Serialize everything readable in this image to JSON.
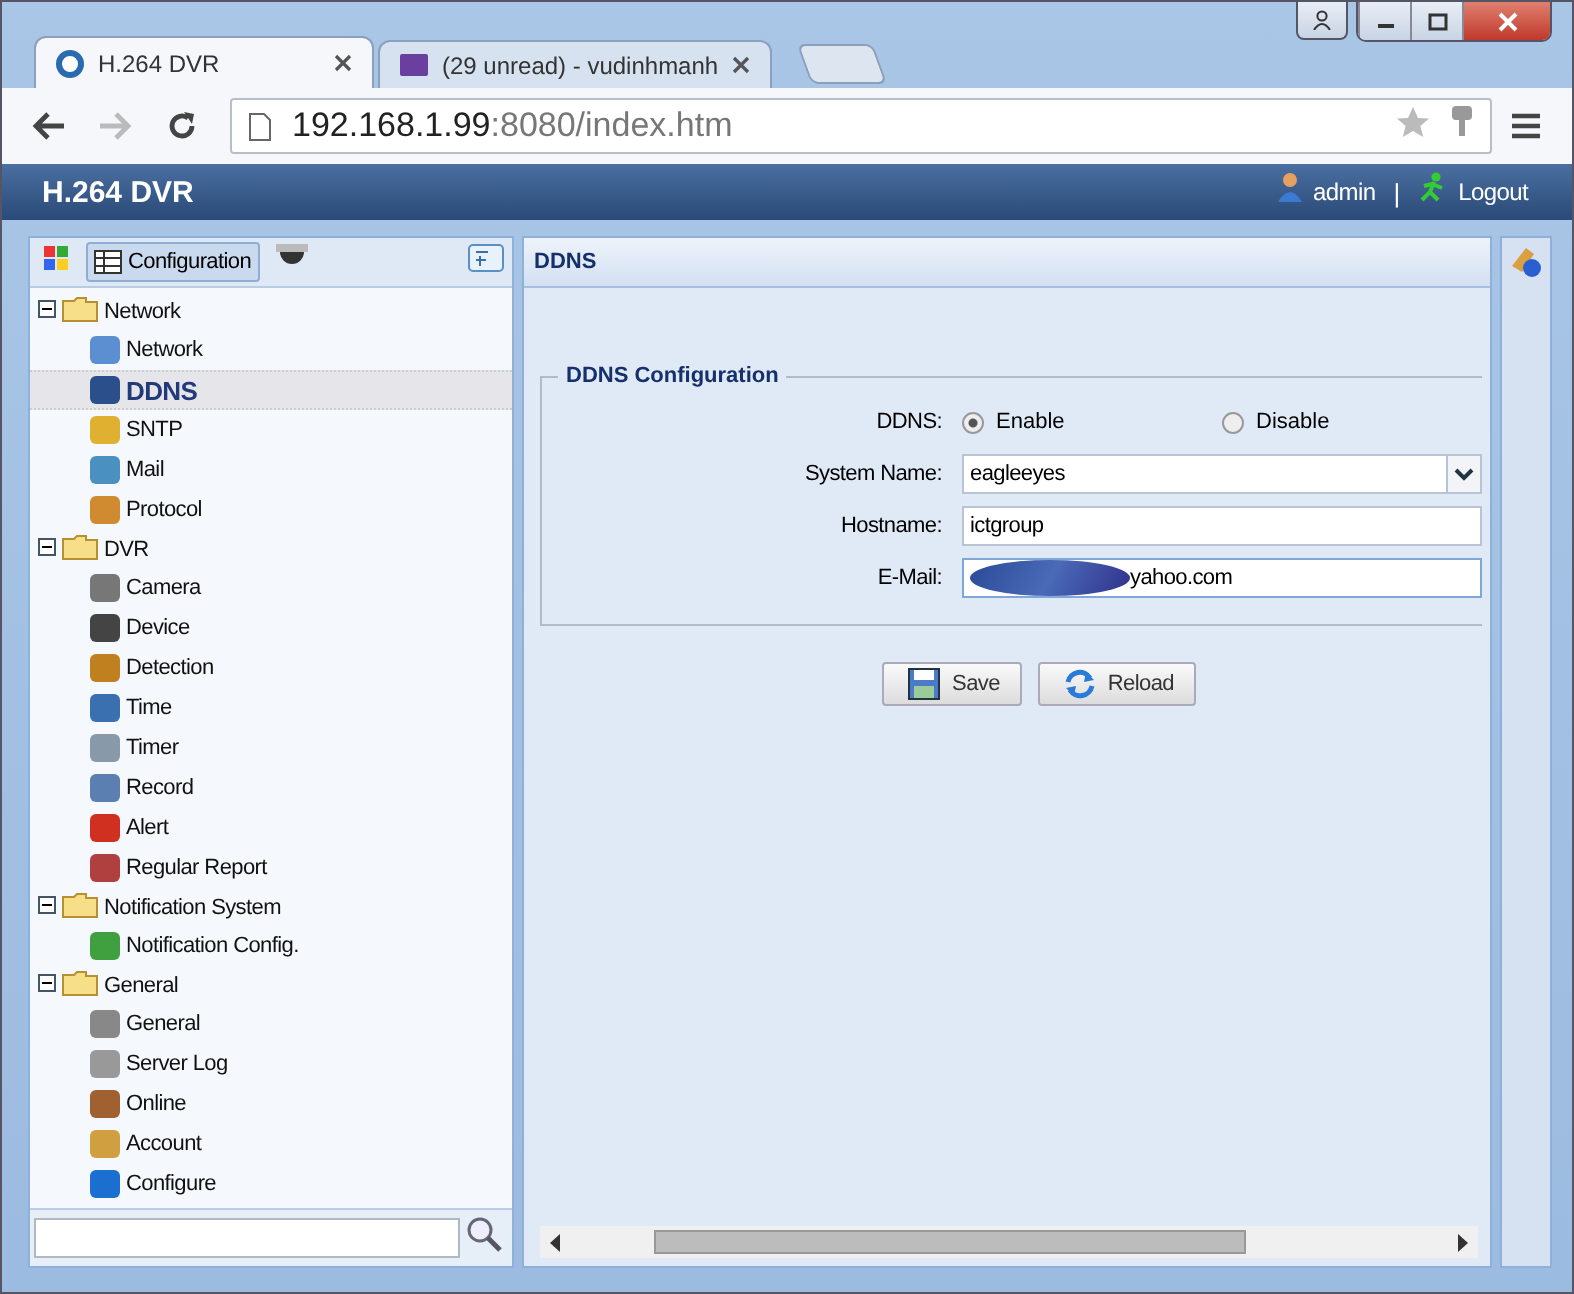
{
  "browser": {
    "tabs": [
      {
        "title": "H.264 DVR",
        "selected": true
      },
      {
        "title": "(29 unread) - vudinhmanh",
        "selected": false
      }
    ],
    "url_host": "192.168.1.99",
    "url_rest": ":8080/index.htm"
  },
  "app": {
    "title": "H.264 DVR",
    "user": "admin",
    "separator": "|",
    "logout": "Logout"
  },
  "sidebar": {
    "configuration": "Configuration",
    "tree": [
      {
        "label": "Network",
        "expanded": true,
        "children": [
          {
            "label": "Network",
            "selected": false
          },
          {
            "label": "DDNS",
            "selected": true
          },
          {
            "label": "SNTP",
            "selected": false
          },
          {
            "label": "Mail",
            "selected": false
          },
          {
            "label": "Protocol",
            "selected": false
          }
        ]
      },
      {
        "label": "DVR",
        "expanded": true,
        "children": [
          {
            "label": "Camera",
            "selected": false
          },
          {
            "label": "Device",
            "selected": false
          },
          {
            "label": "Detection",
            "selected": false
          },
          {
            "label": "Time",
            "selected": false
          },
          {
            "label": "Timer",
            "selected": false
          },
          {
            "label": "Record",
            "selected": false
          },
          {
            "label": "Alert",
            "selected": false
          },
          {
            "label": "Regular Report",
            "selected": false
          }
        ]
      },
      {
        "label": "Notification System",
        "expanded": true,
        "children": [
          {
            "label": "Notification Config.",
            "selected": false
          }
        ]
      },
      {
        "label": "General",
        "expanded": true,
        "children": [
          {
            "label": "General",
            "selected": false
          },
          {
            "label": "Server Log",
            "selected": false
          },
          {
            "label": "Online",
            "selected": false
          },
          {
            "label": "Account",
            "selected": false
          },
          {
            "label": "Configure",
            "selected": false
          }
        ]
      }
    ]
  },
  "panel": {
    "title": "DDNS",
    "group": "DDNS Configuration",
    "ddns_label": "DDNS:",
    "options": [
      {
        "label": "Enable",
        "selected": true
      },
      {
        "label": "Disable",
        "selected": false
      }
    ],
    "fields": [
      {
        "kind": "select",
        "label": "System Name:",
        "value": "eagleeyes"
      },
      {
        "kind": "text",
        "label": "Hostname:",
        "value": "ictgroup"
      },
      {
        "kind": "text",
        "label": "E-Mail:",
        "value": "yahoo.com",
        "redacted": true
      }
    ],
    "buttons": [
      "Save",
      "Reload"
    ]
  }
}
